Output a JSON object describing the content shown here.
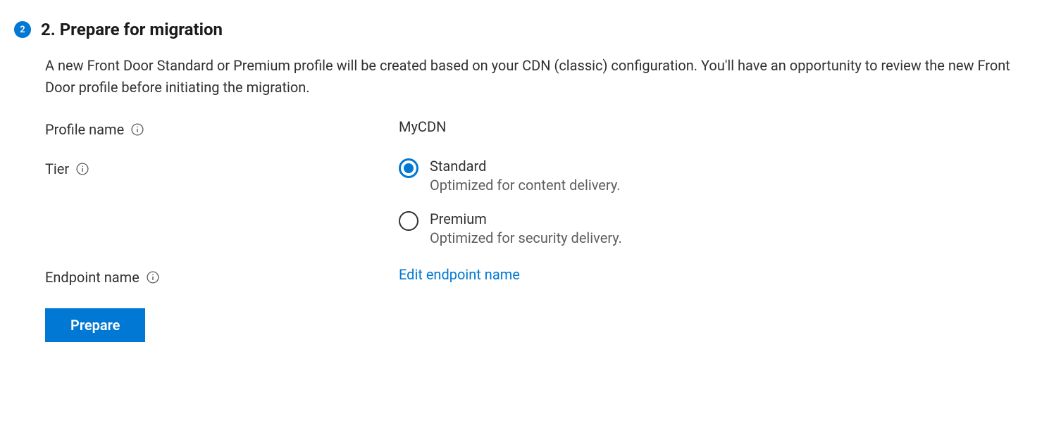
{
  "step": {
    "number": "2",
    "title": "2. Prepare for migration"
  },
  "description": "A new Front Door Standard or Premium profile will be created based on your CDN (classic) configuration. You'll have an opportunity to review the new Front Door profile before initiating the migration.",
  "form": {
    "profileName": {
      "label": "Profile name",
      "value": "MyCDN"
    },
    "tier": {
      "label": "Tier",
      "options": {
        "standard": {
          "label": "Standard",
          "desc": "Optimized for content delivery."
        },
        "premium": {
          "label": "Premium",
          "desc": "Optimized for security delivery."
        }
      }
    },
    "endpointName": {
      "label": "Endpoint name",
      "linkText": "Edit endpoint name"
    },
    "prepareButton": "Prepare"
  }
}
